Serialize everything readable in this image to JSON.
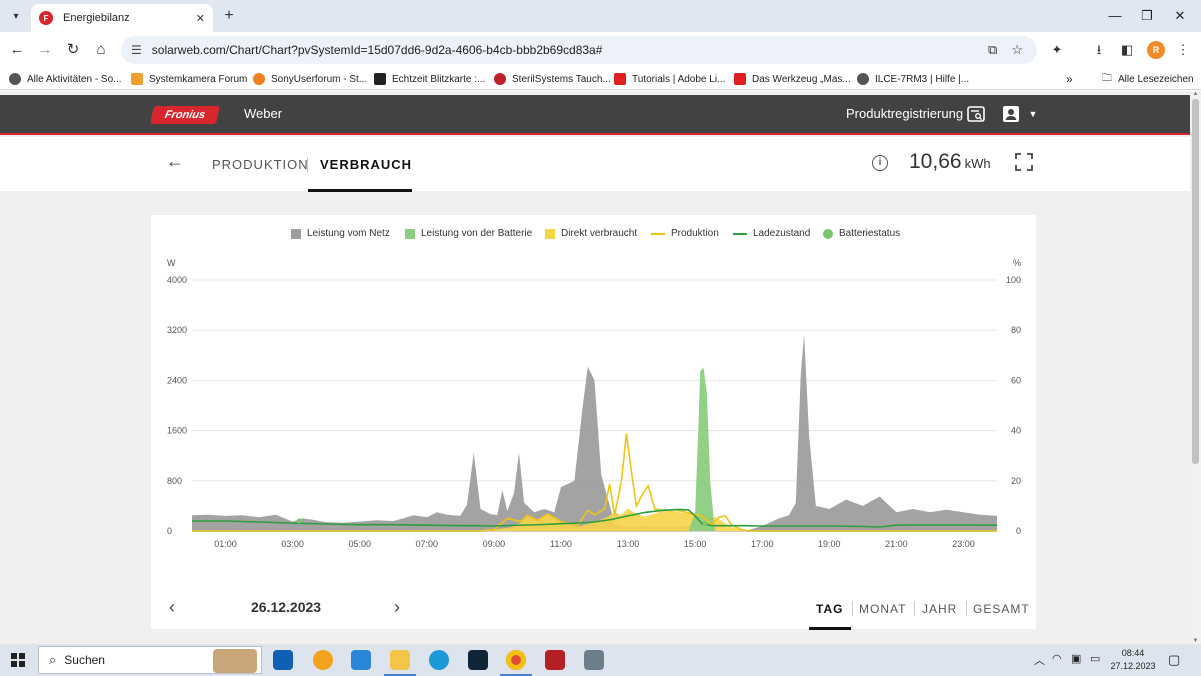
{
  "browser": {
    "tab_title": "Energiebilanz",
    "url": "solarweb.com/Chart/Chart?pvSystemId=15d07dd6-9d2a-4606-b4cb-bbb2b69cd83a#",
    "profile_initial": "R",
    "bookmarks": [
      {
        "label": "Alle Aktivitäten - So...",
        "color": "#555555"
      },
      {
        "label": "Systemkamera Forum",
        "color": "#f0a030"
      },
      {
        "label": "SonyUserforum - St...",
        "color": "#f08020"
      },
      {
        "label": "Echtzeit Blitzkarte :...",
        "color": "#222222"
      },
      {
        "label": "SterilSystems Tauch...",
        "color": "#c0202a"
      },
      {
        "label": "Tutorials | Adobe Li...",
        "color": "#e02020"
      },
      {
        "label": "Das Werkzeug „Mas...",
        "color": "#e02020"
      },
      {
        "label": "ILCE-7RM3 | Hilfe |...",
        "color": "#555555"
      }
    ],
    "all_bookmarks_label": "Alle Lesezeichen"
  },
  "app": {
    "brand": "Fronius",
    "system_name": "Weber",
    "product_registration": "Produktregistrierung",
    "tabs": [
      {
        "label": "PRODUKTION",
        "active": false
      },
      {
        "label": "VERBRAUCH",
        "active": true
      }
    ],
    "energy_value": "10,66",
    "energy_unit": "kWh",
    "date": "26.12.2023",
    "ranges": [
      {
        "label": "TAG",
        "active": true
      },
      {
        "label": "MONAT",
        "active": false
      },
      {
        "label": "JAHR",
        "active": false
      },
      {
        "label": "GESAMT",
        "active": false
      }
    ]
  },
  "chart_data": {
    "type": "area",
    "title": "",
    "legend": [
      {
        "name": "Leistung vom Netz",
        "kind": "area",
        "color": "#9e9e9e"
      },
      {
        "name": "Leistung von der Batterie",
        "kind": "area",
        "color": "#8ccf7e"
      },
      {
        "name": "Direkt verbraucht",
        "kind": "area",
        "color": "#f7d448"
      },
      {
        "name": "Produktion",
        "kind": "line",
        "color": "#f2c414"
      },
      {
        "name": "Ladezustand",
        "kind": "line",
        "color": "#2e9e3e"
      },
      {
        "name": "Batteriestatus",
        "kind": "dot",
        "color": "#7cc56e"
      }
    ],
    "legend_position": "top-center",
    "y_left": {
      "unit": "W",
      "min": 0,
      "max": 4000,
      "ticks": [
        "0",
        "800",
        "1600",
        "2400",
        "3200",
        "4000"
      ]
    },
    "y_right": {
      "unit": "%",
      "min": 0,
      "max": 100,
      "ticks": [
        "0",
        "20",
        "40",
        "60",
        "80",
        "100"
      ]
    },
    "x_hours": {
      "min": 0,
      "max": 24,
      "ticks": [
        "01:00",
        "03:00",
        "05:00",
        "07:00",
        "09:00",
        "11:00",
        "13:00",
        "15:00",
        "17:00",
        "19:00",
        "21:00",
        "23:00"
      ]
    },
    "grid": true,
    "series": [
      {
        "name": "Leistung vom Netz",
        "points": [
          [
            0,
            250
          ],
          [
            0.5,
            260
          ],
          [
            1,
            240
          ],
          [
            1.5,
            250
          ],
          [
            2,
            220
          ],
          [
            2.5,
            260
          ],
          [
            3,
            150
          ],
          [
            3.3,
            200
          ],
          [
            3.6,
            180
          ],
          [
            4,
            140
          ],
          [
            4.5,
            130
          ],
          [
            5,
            150
          ],
          [
            5.5,
            170
          ],
          [
            6,
            160
          ],
          [
            6.3,
            200
          ],
          [
            6.6,
            250
          ],
          [
            7,
            220
          ],
          [
            7.3,
            300
          ],
          [
            7.6,
            260
          ],
          [
            8,
            240
          ],
          [
            8.2,
            420
          ],
          [
            8.4,
            1250
          ],
          [
            8.6,
            350
          ],
          [
            8.9,
            270
          ],
          [
            9.1,
            250
          ],
          [
            9.25,
            650
          ],
          [
            9.4,
            320
          ],
          [
            9.6,
            600
          ],
          [
            9.75,
            1250
          ],
          [
            9.9,
            450
          ],
          [
            10.2,
            300
          ],
          [
            10.5,
            350
          ],
          [
            10.8,
            300
          ],
          [
            11,
            700
          ],
          [
            11.4,
            800
          ],
          [
            11.65,
            2000
          ],
          [
            11.8,
            2620
          ],
          [
            12,
            2400
          ],
          [
            12.2,
            900
          ],
          [
            12.6,
            120
          ],
          [
            13,
            60
          ],
          [
            13.5,
            80
          ],
          [
            14,
            60
          ],
          [
            14.5,
            60
          ],
          [
            14.75,
            80
          ],
          [
            15,
            100
          ],
          [
            15.25,
            300
          ],
          [
            15.5,
            0
          ],
          [
            16.5,
            0
          ],
          [
            17,
            80
          ],
          [
            17.5,
            200
          ],
          [
            17.8,
            250
          ],
          [
            18,
            450
          ],
          [
            18.15,
            2500
          ],
          [
            18.25,
            3130
          ],
          [
            18.4,
            1500
          ],
          [
            18.6,
            400
          ],
          [
            19,
            350
          ],
          [
            19.5,
            500
          ],
          [
            20,
            400
          ],
          [
            20.5,
            550
          ],
          [
            21,
            300
          ],
          [
            21.5,
            350
          ],
          [
            22,
            300
          ],
          [
            22.5,
            340
          ],
          [
            23,
            300
          ],
          [
            23.5,
            260
          ],
          [
            24,
            240
          ]
        ]
      },
      {
        "name": "Leistung von der Batterie",
        "points": [
          [
            14.8,
            0
          ],
          [
            15.0,
            280
          ],
          [
            15.1,
            1700
          ],
          [
            15.15,
            2550
          ],
          [
            15.25,
            2600
          ],
          [
            15.35,
            2200
          ],
          [
            15.45,
            800
          ],
          [
            15.55,
            200
          ],
          [
            15.6,
            0
          ]
        ]
      },
      {
        "name": "Direkt verbraucht",
        "points": [
          [
            0,
            0
          ],
          [
            8.5,
            0
          ],
          [
            9,
            20
          ],
          [
            9.5,
            60
          ],
          [
            9.8,
            130
          ],
          [
            10,
            230
          ],
          [
            10.3,
            160
          ],
          [
            10.6,
            260
          ],
          [
            11,
            130
          ],
          [
            11.5,
            70
          ],
          [
            12,
            140
          ],
          [
            12.4,
            230
          ],
          [
            12.6,
            300
          ],
          [
            12.8,
            250
          ],
          [
            13,
            360
          ],
          [
            13.2,
            280
          ],
          [
            13.5,
            230
          ],
          [
            13.8,
            280
          ],
          [
            14,
            320
          ],
          [
            14.3,
            330
          ],
          [
            14.5,
            300
          ],
          [
            14.8,
            280
          ],
          [
            15,
            260
          ],
          [
            15.3,
            240
          ],
          [
            15.6,
            220
          ],
          [
            15.8,
            160
          ],
          [
            16,
            80
          ],
          [
            16.3,
            30
          ],
          [
            16.6,
            0
          ],
          [
            24,
            0
          ]
        ]
      },
      {
        "name": "Produktion",
        "points": [
          [
            0,
            0
          ],
          [
            8.5,
            0
          ],
          [
            9,
            20
          ],
          [
            9.4,
            200
          ],
          [
            9.8,
            150
          ],
          [
            10,
            250
          ],
          [
            10.3,
            170
          ],
          [
            10.6,
            270
          ],
          [
            11,
            150
          ],
          [
            11.5,
            90
          ],
          [
            11.8,
            330
          ],
          [
            12,
            260
          ],
          [
            12.3,
            350
          ],
          [
            12.45,
            750
          ],
          [
            12.6,
            250
          ],
          [
            12.8,
            780
          ],
          [
            12.95,
            1550
          ],
          [
            13.1,
            950
          ],
          [
            13.25,
            400
          ],
          [
            13.45,
            600
          ],
          [
            13.6,
            720
          ],
          [
            13.8,
            350
          ],
          [
            14,
            330
          ],
          [
            14.4,
            340
          ],
          [
            14.8,
            290
          ],
          [
            15.2,
            240
          ],
          [
            15.5,
            100
          ],
          [
            15.7,
            220
          ],
          [
            15.9,
            240
          ],
          [
            16.1,
            90
          ],
          [
            16.4,
            20
          ],
          [
            16.6,
            0
          ],
          [
            24,
            0
          ]
        ]
      },
      {
        "name": "Ladezustand",
        "points": [
          [
            0,
            4
          ],
          [
            1,
            4
          ],
          [
            2,
            3.6
          ],
          [
            3,
            3.1
          ],
          [
            4,
            2.8
          ],
          [
            5,
            2.5
          ],
          [
            6,
            2.5
          ],
          [
            7,
            2.3
          ],
          [
            8,
            2.1
          ],
          [
            8.5,
            2.1
          ],
          [
            9,
            2
          ],
          [
            10,
            2.4
          ],
          [
            10.5,
            2.6
          ],
          [
            11,
            2.9
          ],
          [
            11.5,
            3.2
          ],
          [
            12,
            3.6
          ],
          [
            12.5,
            4.6
          ],
          [
            13,
            6
          ],
          [
            13.5,
            7.4
          ],
          [
            14,
            8.2
          ],
          [
            14.5,
            8.6
          ],
          [
            14.8,
            8.4
          ],
          [
            15,
            6
          ],
          [
            15.2,
            3
          ],
          [
            15.5,
            2.1
          ],
          [
            16,
            2.1
          ],
          [
            16.5,
            2.1
          ],
          [
            17,
            2
          ],
          [
            18,
            2
          ],
          [
            19,
            2
          ],
          [
            20,
            1.8
          ],
          [
            20.5,
            1.6
          ],
          [
            21,
            2.3
          ],
          [
            21.5,
            2.4
          ],
          [
            22,
            2.4
          ],
          [
            23,
            2.4
          ],
          [
            24,
            2.3
          ]
        ]
      },
      {
        "name": "Batteriestatus",
        "points": [
          [
            3.2,
            4
          ],
          [
            15.3,
            3
          ]
        ]
      }
    ]
  }
}
